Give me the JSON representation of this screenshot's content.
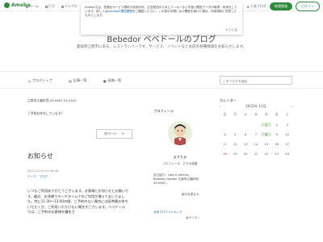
{
  "topbar": {
    "logo_text": "Ameba",
    "nav": [
      "ホーム",
      "ピグ",
      "アメブロ"
    ],
    "follow_label": "人気ブログ",
    "register_label": "新規登録",
    "login_label": "ログイン"
  },
  "cookie": {
    "text_before": "Amebaでは、快適なサービス提供や利用分析、広告配信のためにクッキーなどを使い閲覧データの取得・利用をしています。詳しくは",
    "link_text": "Amebaの閲覧履歴",
    "text_after": "をご確認ください。この表示を閉じるか閲覧を続けた場合、利用規約に同意したものとします。",
    "close_label": "とじる"
  },
  "blog": {
    "title": "Bebedor ベベドールのブログ",
    "subtitle": "愛知県江南市にある、レストランバーです。サービス、イベントなどお店の各種情報をお知らせします。"
  },
  "subnav": {
    "items": [
      "ブログトップ",
      "記事一覧",
      "画像一覧"
    ],
    "search_placeholder": "このブログを検索"
  },
  "main": {
    "info": "江南市江森町西 09 0587-53-0247",
    "welcome": "ご予約お待ちしています！",
    "next_label": "次ページ",
    "post_title": "お知らせ",
    "post_date": "2022-10-04 05:36:46",
    "post_theme": "テーマ：ブログ",
    "post_body": "いつもご利用ありがとうございます。お客様にお知らせとお願いです。最近、お休憩でランチタイムでのご利用が増えてまいりました。特に11:30〜13:00の間、ご予約のない場合には長時間お待ちいただくか、ご利用いただけない場合がございます。ベベドールでは、ご予約のお客様を優先さ"
  },
  "profile": {
    "heading": "プロフィール",
    "name": "ますたぁ",
    "links": "プロフィール　ピグの部屋",
    "desc": "自己紹介：cafe & kitchen Bebedor Garden 江南市江森町西09-0587...",
    "more": "続きを見る ▾",
    "ranking": "全体ブログランキング",
    "all_theme": "全テーマ ›"
  },
  "calendar": {
    "heading": "カレンダー",
    "month": "2022年 12月",
    "prev": "‹",
    "next": "›",
    "weekdays": [
      "日",
      "月",
      "火",
      "水",
      "木",
      "金",
      "土"
    ],
    "days": [
      "",
      "",
      "",
      "",
      "1",
      "2",
      "3",
      "4",
      "5",
      "6",
      "7",
      "8",
      "9",
      "10",
      "11",
      "12",
      "13",
      "14",
      "15",
      "16",
      "17",
      "18",
      "19",
      "20",
      "21",
      "22",
      "23",
      "24"
    ],
    "highlighted": [
      "1",
      "8"
    ]
  },
  "colors": {
    "accent": "#2d8c3c",
    "link": "#2b6cb0"
  }
}
